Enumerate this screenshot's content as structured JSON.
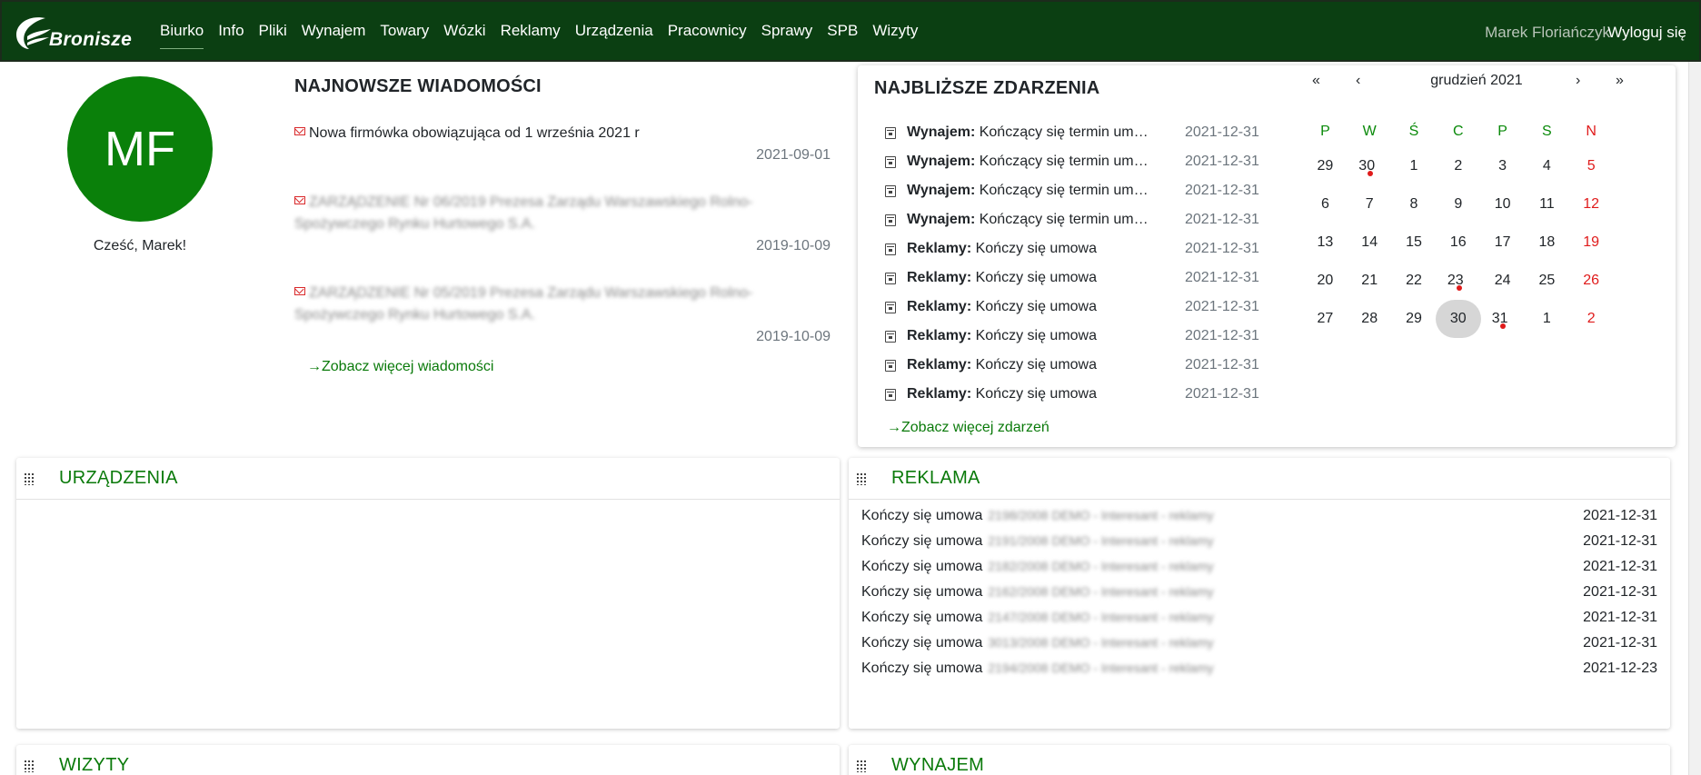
{
  "brand": {
    "logo_text": "Bronisze"
  },
  "nav": {
    "items": [
      {
        "label": "Biurko",
        "active": true
      },
      {
        "label": "Info"
      },
      {
        "label": "Pliki"
      },
      {
        "label": "Wynajem"
      },
      {
        "label": "Towary"
      },
      {
        "label": "Wózki"
      },
      {
        "label": "Reklamy"
      },
      {
        "label": "Urządzenia"
      },
      {
        "label": "Pracownicy"
      },
      {
        "label": "Sprawy"
      },
      {
        "label": "SPB"
      },
      {
        "label": "Wizyty"
      }
    ],
    "user_name": "Marek Floriańczyk",
    "logout_label": "Wyloguj się"
  },
  "profile": {
    "initials": "MF",
    "greeting": "Cześć, Marek!"
  },
  "news": {
    "title": "NAJNOWSZE WIADOMOŚCI",
    "items": [
      {
        "text": "Nowa firmówka obowiązująca od 1 września 2021 r",
        "date": "2021-09-01"
      },
      {
        "text": "ZARZĄDZENIE Nr 06/2019 Prezesa Zarządu Warszawskiego Rolno-Spożywczego Rynku Hurtowego S.A.",
        "date": "2019-10-09"
      },
      {
        "text": "ZARZĄDZENIE Nr 05/2019 Prezesa Zarządu Warszawskiego Rolno-Spożywczego Rynku Hurtowego S.A.",
        "date": "2019-10-09"
      }
    ],
    "see_more": "→Zobacz więcej wiadomości"
  },
  "events": {
    "title": "NAJBLIŻSZE ZDARZENIA",
    "items": [
      {
        "category": "Wynajem:",
        "text": "Kończący się termin umowy",
        "date": "2021-12-31"
      },
      {
        "category": "Wynajem:",
        "text": "Kończący się termin umowy",
        "date": "2021-12-31"
      },
      {
        "category": "Wynajem:",
        "text": "Kończący się termin umowy",
        "date": "2021-12-31"
      },
      {
        "category": "Wynajem:",
        "text": "Kończący się termin umowy",
        "date": "2021-12-31"
      },
      {
        "category": "Reklamy:",
        "text": "Kończy się umowa",
        "date": "2021-12-31"
      },
      {
        "category": "Reklamy:",
        "text": "Kończy się umowa",
        "date": "2021-12-31"
      },
      {
        "category": "Reklamy:",
        "text": "Kończy się umowa",
        "date": "2021-12-31"
      },
      {
        "category": "Reklamy:",
        "text": "Kończy się umowa",
        "date": "2021-12-31"
      },
      {
        "category": "Reklamy:",
        "text": "Kończy się umowa",
        "date": "2021-12-31"
      },
      {
        "category": "Reklamy:",
        "text": "Kończy się umowa",
        "date": "2021-12-31"
      }
    ],
    "see_more": "→Zobacz więcej zdarzeń"
  },
  "calendar": {
    "nav": {
      "prev_year": "«",
      "prev_month": "‹",
      "next_month": "›",
      "next_year": "»"
    },
    "month_label": "grudzień 2021",
    "weekdays": [
      "P",
      "W",
      "Ś",
      "C",
      "P",
      "S",
      "N"
    ],
    "weeks": [
      [
        "29",
        "30",
        "1",
        "2",
        "3",
        "4",
        "5"
      ],
      [
        "6",
        "7",
        "8",
        "9",
        "10",
        "11",
        "12"
      ],
      [
        "13",
        "14",
        "15",
        "16",
        "17",
        "18",
        "19"
      ],
      [
        "20",
        "21",
        "22",
        "23",
        "24",
        "25",
        "26"
      ],
      [
        "27",
        "28",
        "29",
        "30",
        "31",
        "1",
        "2"
      ]
    ],
    "today": [
      4,
      3
    ],
    "event_days": [
      [
        0,
        1
      ],
      [
        3,
        3
      ],
      [
        4,
        4
      ]
    ]
  },
  "widgets": {
    "urzadzenia": {
      "title": "URZĄDZENIA"
    },
    "reklama": {
      "title": "REKLAMA",
      "rows": [
        {
          "label": "Kończy się umowa",
          "detail": "2198/2008 DEMO - Interesant - reklamy",
          "date": "2021-12-31"
        },
        {
          "label": "Kończy się umowa",
          "detail": "2191/2008 DEMO - Interesant - reklamy",
          "date": "2021-12-31"
        },
        {
          "label": "Kończy się umowa",
          "detail": "2182/2008 DEMO - Interesant - reklamy",
          "date": "2021-12-31"
        },
        {
          "label": "Kończy się umowa",
          "detail": "2162/2008 DEMO - Interesant - reklamy",
          "date": "2021-12-31"
        },
        {
          "label": "Kończy się umowa",
          "detail": "2147/2008 DEMO - Interesant - reklamy",
          "date": "2021-12-31"
        },
        {
          "label": "Kończy się umowa",
          "detail": "3013/2008 DEMO - Interesant - reklamy",
          "date": "2021-12-31"
        },
        {
          "label": "Kończy się umowa",
          "detail": "2194/2008 DEMO - Interesant - reklamy",
          "date": "2021-12-23"
        }
      ]
    },
    "wizyty": {
      "title": "WIZYTY"
    },
    "wynajem": {
      "title": "WYNAJEM"
    }
  },
  "colors": {
    "navbar": "#0b3f12",
    "accent": "#0a7a0a",
    "avatar": "#0a800a",
    "holiday": "#e01b1b"
  }
}
